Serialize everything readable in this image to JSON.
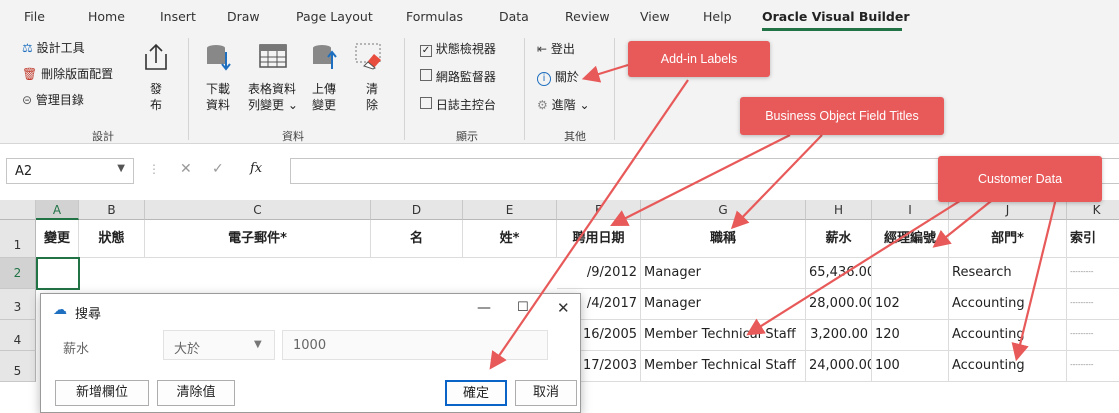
{
  "menu": {
    "tabs": [
      "File",
      "Home",
      "Insert",
      "Draw",
      "Page Layout",
      "Formulas",
      "Data",
      "Review",
      "View",
      "Help",
      "Oracle Visual Builder"
    ],
    "active_tab": "Oracle Visual Builder"
  },
  "ribbon": {
    "design": {
      "designer": "設計工具",
      "delete_layout": "刪除版面配置",
      "manage_catalog": "管理目錄",
      "publish_line1": "發",
      "publish_line2": "布",
      "group_label": "設計"
    },
    "data": {
      "download_line1": "下載",
      "download_line2": "資料",
      "table_line1": "表格資料",
      "table_line2": "列變更",
      "upload_line1": "上傳",
      "upload_line2": "變更",
      "clear_line1": "清",
      "clear_line2": "除",
      "group_label": "資料"
    },
    "show": {
      "status_viewer": "狀態檢視器",
      "network_monitor": "網路監督器",
      "log_console": "日誌主控台",
      "group_label": "顯示"
    },
    "other": {
      "logout": "登出",
      "about": "關於",
      "advanced": "進階",
      "group_label": "其他"
    }
  },
  "formula_bar": {
    "name_box": "A2",
    "fx": "fx"
  },
  "columns": [
    "A",
    "B",
    "C",
    "D",
    "E",
    "F",
    "G",
    "H",
    "I",
    "J",
    "K"
  ],
  "rows": [
    "1",
    "2",
    "3",
    "4",
    "5"
  ],
  "sheet": {
    "headers": [
      "變更",
      "狀態",
      "電子郵件*",
      "名",
      "姓*",
      "聘用日期",
      "職稱",
      "薪水",
      "經理編號",
      "部門*",
      "索引"
    ],
    "data": [
      {
        "hire": "/9/2012",
        "title": "Manager",
        "salary": "65,436.00",
        "manager": "",
        "dept": "Research"
      },
      {
        "hire": "/4/2017",
        "title": "Manager",
        "salary": "28,000.00",
        "manager": "102",
        "dept": "Accounting"
      },
      {
        "hire": "16/2005",
        "title": "Member Technical Staff",
        "salary": "3,200.00",
        "manager": "120",
        "dept": "Accounting"
      },
      {
        "hire": "17/2003",
        "title": "Member Technical Staff",
        "salary": "24,000.00",
        "manager": "100",
        "dept": "Accounting"
      }
    ]
  },
  "dialog": {
    "title": "搜尋",
    "field_label": "薪水",
    "operator": "大於",
    "value": "1000",
    "add_field": "新增欄位",
    "clear_values": "清除值",
    "ok": "確定",
    "cancel": "取消"
  },
  "callouts": {
    "addin_labels": "Add-in Labels",
    "field_titles": "Business Object Field Titles",
    "customer_data": "Customer Data"
  },
  "colors": {
    "callout": "#e85a5a",
    "accent": "#217346"
  }
}
